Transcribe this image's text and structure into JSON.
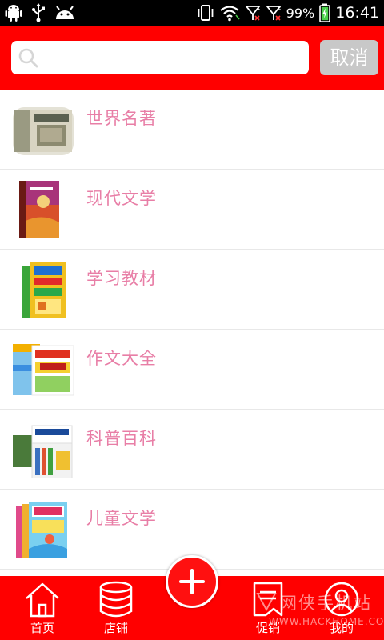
{
  "status_bar": {
    "battery": "99%",
    "time": "16:41",
    "icons": [
      "android-icon",
      "usb-icon",
      "android-debug-icon",
      "vibrate-icon",
      "wifi-icon",
      "signal-1-icon",
      "signal-2-icon",
      "battery-icon"
    ]
  },
  "search": {
    "placeholder": "",
    "value": "",
    "cancel_label": "取消"
  },
  "categories": [
    {
      "label": "世界名著"
    },
    {
      "label": "现代文学"
    },
    {
      "label": "学习教材"
    },
    {
      "label": "作文大全"
    },
    {
      "label": "科普百科"
    },
    {
      "label": "儿童文学"
    }
  ],
  "bottom_nav": {
    "items": [
      {
        "label": "首页",
        "icon": "home-icon"
      },
      {
        "label": "店铺",
        "icon": "database-icon"
      },
      {
        "label": "促销",
        "icon": "promotion-icon"
      },
      {
        "label": "我的",
        "icon": "user-icon"
      }
    ],
    "fab_icon": "plus-icon"
  },
  "watermark": {
    "main": "网侠手机站",
    "sub": "WWW.HACKHOME.COM"
  },
  "colors": {
    "primary": "#ff0000",
    "category_text": "#e87ea6",
    "cancel_button": "#c8c8c8",
    "status_bar": "#000000"
  }
}
